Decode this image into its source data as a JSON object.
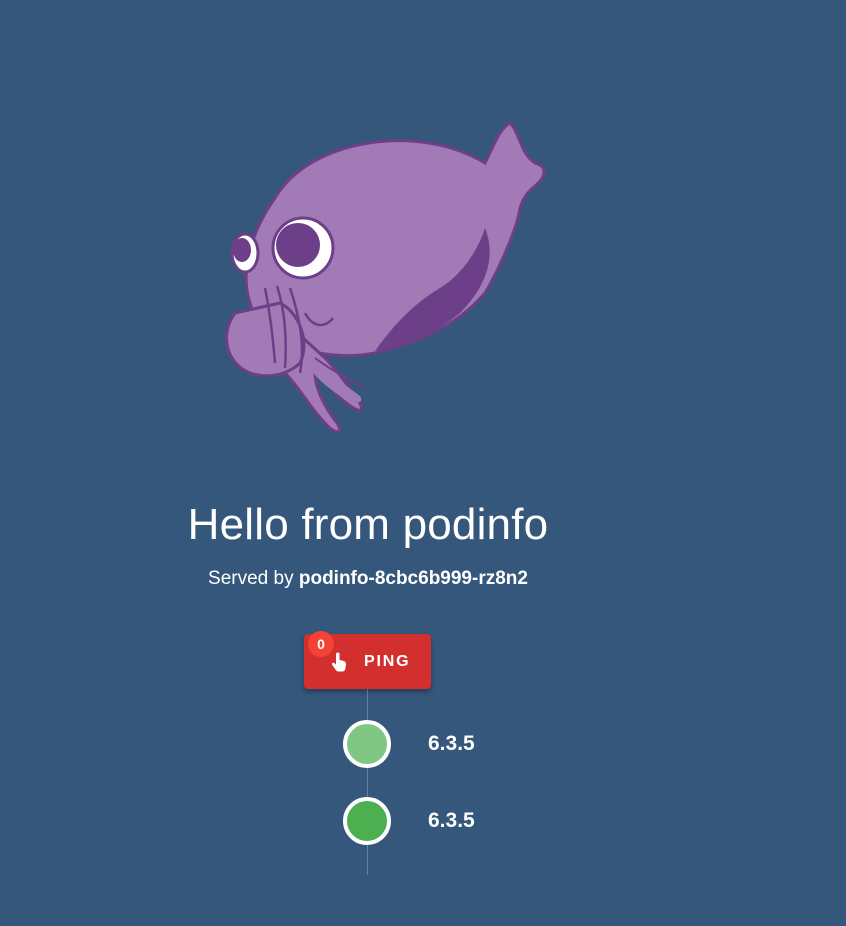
{
  "main": {
    "title": "Hello from podinfo",
    "served_by_prefix": "Served by",
    "hostname": "podinfo-8cbc6b999-rz8n2",
    "ping": {
      "label": "PING",
      "count": "0",
      "icon": "touch-app-icon"
    },
    "timeline": [
      {
        "version": "6.3.5",
        "color": "#81c784"
      },
      {
        "version": "6.3.5",
        "color": "#4caf50"
      }
    ]
  },
  "colors": {
    "background": "#34577b",
    "button": "#d32f2f",
    "badge": "#f44336",
    "mascot_body": "#a27ab6",
    "mascot_shade": "#6c3f88"
  }
}
